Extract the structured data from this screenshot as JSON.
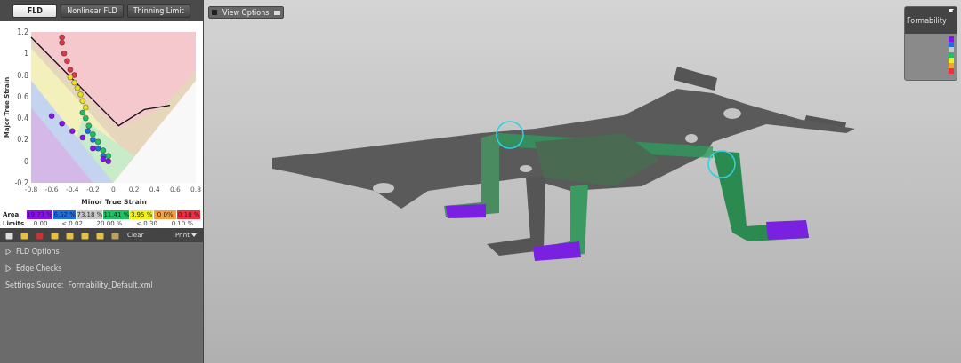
{
  "tabs": [
    {
      "label": "FLD",
      "selected": true
    },
    {
      "label": "Nonlinear FLD",
      "selected": false
    },
    {
      "label": "Thinning Limit",
      "selected": false
    }
  ],
  "fld_plot": {
    "xlabel": "Minor True Strain",
    "ylabel": "Major True Strain",
    "x_ticks": [
      "-0.8",
      "-0.6",
      "-0.4",
      "-0.2",
      "0",
      "0.2",
      "0.4",
      "0.6",
      "0.8"
    ],
    "y_ticks": [
      "1.2",
      "1",
      "0.8",
      "0.6",
      "0.4",
      "0.2",
      "0",
      "-0.2"
    ]
  },
  "legend": {
    "area_label": "Area",
    "limits_label": "Limits",
    "area": [
      {
        "value": "19.73 %",
        "color": "#8a10f0"
      },
      {
        "value": "6.52 %",
        "color": "#1e6fe0"
      },
      {
        "value": "73.18 %",
        "color": "#c8c8c8"
      },
      {
        "value": "11.41 %",
        "color": "#20c060"
      },
      {
        "value": "3.95 %",
        "color": "#f0f020"
      },
      {
        "value": "0 0%",
        "color": "#f8a040"
      },
      {
        "value": "0.10 %",
        "color": "#f03040"
      }
    ],
    "limits": [
      "0.00",
      "< 0.02",
      "20.00 %",
      "< 0.30",
      "0.10 %"
    ]
  },
  "toolbar": {
    "clear": "Clear",
    "print": "Print"
  },
  "options": [
    {
      "label": "FLD Options",
      "expanded": false
    },
    {
      "label": "Edge Checks",
      "expanded": false
    }
  ],
  "settings_source": {
    "label": "Settings Source:",
    "value": "Formability_Default.xml"
  },
  "view_options": {
    "label": "View Options"
  },
  "formability_legend": {
    "title": "Formability",
    "swatches": [
      {
        "color": "#8a10f0"
      },
      {
        "color": "#1e6fe0"
      },
      {
        "color": "#c8c8c8"
      },
      {
        "color": "#20c060"
      },
      {
        "color": "#f0f020"
      },
      {
        "color": "#f8a040"
      },
      {
        "color": "#f03040"
      }
    ]
  }
}
